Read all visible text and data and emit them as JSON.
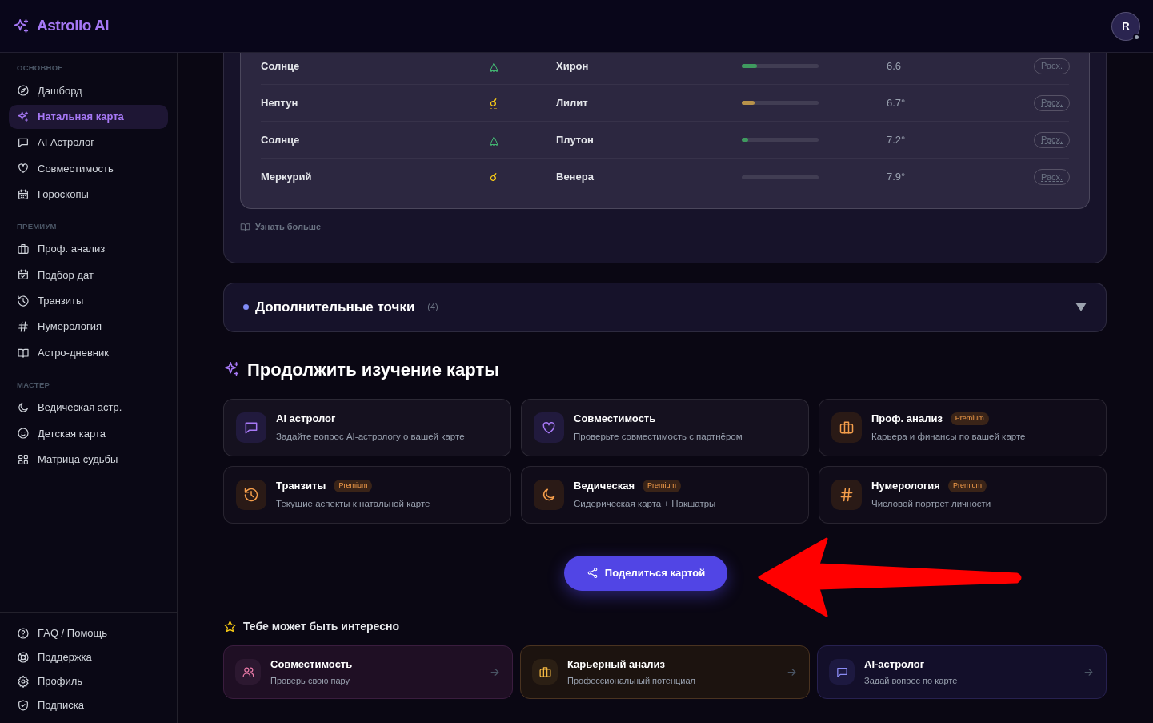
{
  "app": {
    "name": "Astrollo AI",
    "avatar_letter": "R"
  },
  "sidebar": {
    "sections": [
      {
        "title": "ОСНОВНОЕ",
        "items": [
          {
            "label": "Дашборд",
            "selected": false
          },
          {
            "label": "Натальная карта",
            "selected": true
          },
          {
            "label": "AI Астролог",
            "selected": false
          },
          {
            "label": "Совместимость",
            "selected": false
          },
          {
            "label": "Гороскопы",
            "selected": false
          }
        ]
      },
      {
        "title": "ПРЕМИУМ",
        "items": [
          {
            "label": "Проф. анализ",
            "selected": false
          },
          {
            "label": "Подбор дат",
            "selected": false
          },
          {
            "label": "Транзиты",
            "selected": false
          },
          {
            "label": "Нумерология",
            "selected": false
          },
          {
            "label": "Астро-дневник",
            "selected": false
          }
        ]
      },
      {
        "title": "МАСТЕР",
        "items": [
          {
            "label": "Ведическая астр.",
            "selected": false
          },
          {
            "label": "Детская карта",
            "selected": false
          },
          {
            "label": "Матрица судьбы",
            "selected": false
          }
        ]
      }
    ],
    "footer": [
      {
        "label": "FAQ / Помощь"
      },
      {
        "label": "Поддержка"
      },
      {
        "label": "Профиль"
      },
      {
        "label": "Подписка"
      }
    ]
  },
  "aspects": {
    "rows": [
      {
        "planet_1": "Солнце",
        "kind": "trine",
        "symbol": "△",
        "planet_2": "Хирон",
        "level": 0.2,
        "orb": "6.6",
        "action": "Расх."
      },
      {
        "planet_1": "Нептун",
        "kind": "conjunction",
        "symbol": "☌",
        "planet_2": "Лилит",
        "level": 0.17,
        "orb": "6.7°",
        "action": "Расх."
      },
      {
        "planet_1": "Солнце",
        "kind": "trine",
        "symbol": "△",
        "planet_2": "Плутон",
        "level": 0.08,
        "orb": "7.2°",
        "action": "Расх."
      },
      {
        "planet_1": "Меркурий",
        "kind": "conjunction",
        "symbol": "☌",
        "planet_2": "Венера",
        "level": 0,
        "orb": "7.9°",
        "action": "Расх."
      }
    ],
    "learn_more": "Узнать больше"
  },
  "extra_points": {
    "title": "Дополнительные точки",
    "count": "(4)",
    "expanded": false
  },
  "continue": {
    "title": "Продолжить изучение карты",
    "cards": [
      {
        "title": "AI астролог",
        "subtitle": "Задайте вопрос AI-астрологу о вашей карте"
      },
      {
        "title": "Совместимость",
        "subtitle": "Проверьте совместимость с партнёром"
      },
      {
        "title": "Проф. анализ",
        "badge": "Premium",
        "subtitle": "Карьера и финансы по вашей карте"
      },
      {
        "title": "Транзиты",
        "badge": "Premium",
        "subtitle": "Текущие аспекты к натальной карте"
      },
      {
        "title": "Ведическая",
        "badge": "Premium",
        "subtitle": "Сидерическая карта + Накшатры"
      },
      {
        "title": "Нумерология",
        "badge": "Premium",
        "subtitle": "Числовой портрет личности"
      }
    ]
  },
  "share_button": "Поделиться картой",
  "suggestions": {
    "title": "Тебе может быть интересно",
    "cards": [
      {
        "title": "Совместимость",
        "subtitle": "Проверь свою пару"
      },
      {
        "title": "Карьерный анализ",
        "subtitle": "Профессиональный потенциал"
      },
      {
        "title": "AI-астролог",
        "subtitle": "Задай вопрос по карте"
      }
    ]
  }
}
